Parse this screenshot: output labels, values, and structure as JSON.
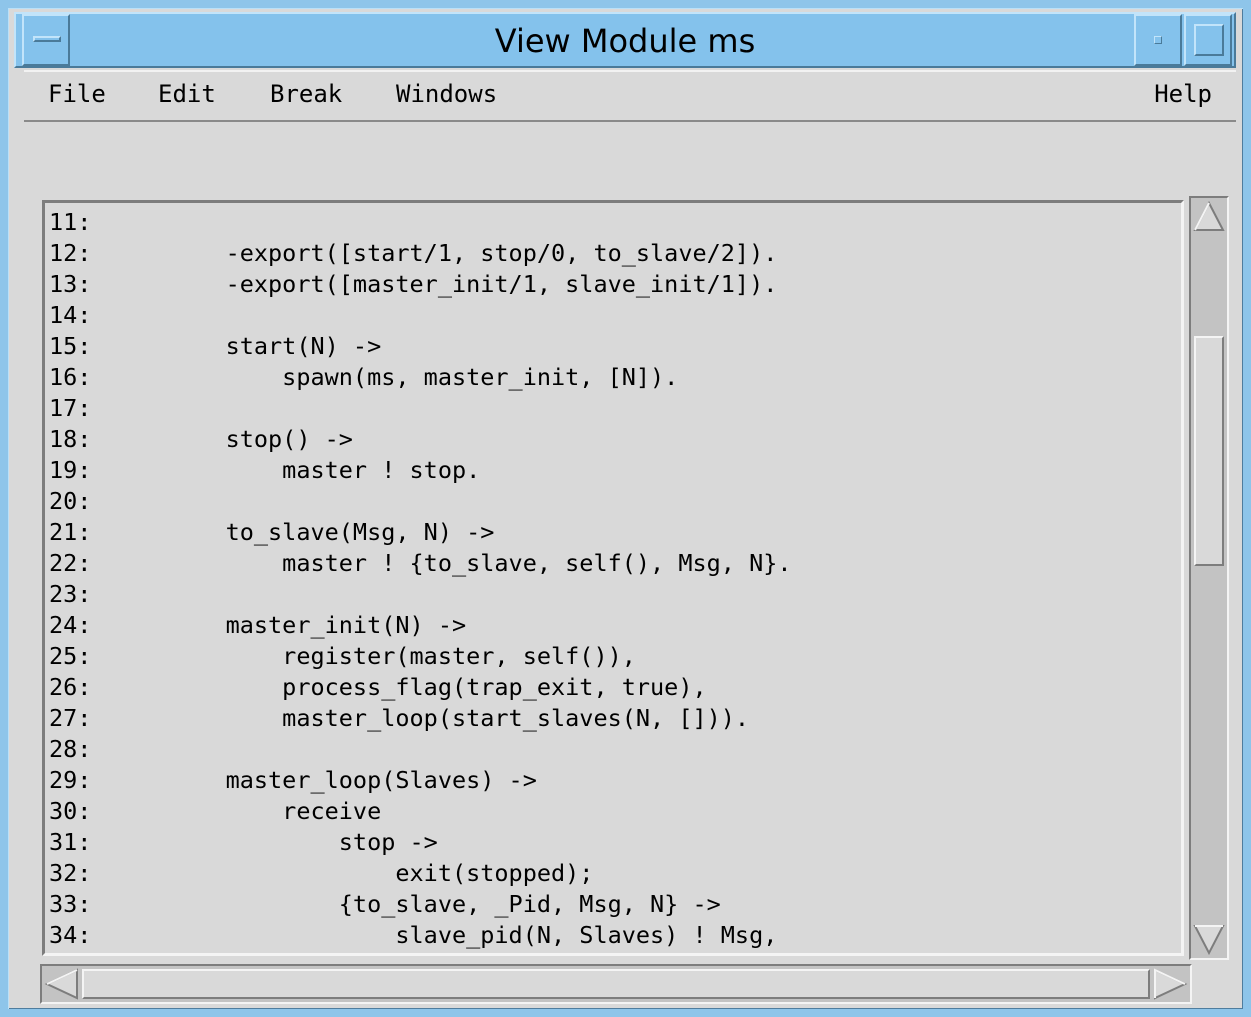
{
  "window": {
    "title": "View Module ms",
    "frame_color": "#84c2ec",
    "background_color": "#d9d9d9"
  },
  "title_buttons": {
    "window_menu_icon": "window-menu-icon",
    "minimize_icon": "minimize-icon",
    "maximize_icon": "maximize-icon"
  },
  "menubar": {
    "file": "File",
    "edit": "Edit",
    "break": "Break",
    "windows": "Windows",
    "help": "Help"
  },
  "code": {
    "lines": [
      {
        "num": "11:",
        "text": ""
      },
      {
        "num": "12:",
        "text": "    -export([start/1, stop/0, to_slave/2])."
      },
      {
        "num": "13:",
        "text": "    -export([master_init/1, slave_init/1])."
      },
      {
        "num": "14:",
        "text": ""
      },
      {
        "num": "15:",
        "text": "    start(N) ->"
      },
      {
        "num": "16:",
        "text": "        spawn(ms, master_init, [N])."
      },
      {
        "num": "17:",
        "text": ""
      },
      {
        "num": "18:",
        "text": "    stop() ->"
      },
      {
        "num": "19:",
        "text": "        master ! stop."
      },
      {
        "num": "20:",
        "text": ""
      },
      {
        "num": "21:",
        "text": "    to_slave(Msg, N) ->"
      },
      {
        "num": "22:",
        "text": "        master ! {to_slave, self(), Msg, N}."
      },
      {
        "num": "23:",
        "text": ""
      },
      {
        "num": "24:",
        "text": "    master_init(N) ->"
      },
      {
        "num": "25:",
        "text": "        register(master, self()),"
      },
      {
        "num": "26:",
        "text": "        process_flag(trap_exit, true),"
      },
      {
        "num": "27:",
        "text": "        master_loop(start_slaves(N, []))."
      },
      {
        "num": "28:",
        "text": ""
      },
      {
        "num": "29:",
        "text": "    master_loop(Slaves) ->"
      },
      {
        "num": "30:",
        "text": "        receive"
      },
      {
        "num": "31:",
        "text": "            stop ->"
      },
      {
        "num": "32:",
        "text": "                exit(stopped);"
      },
      {
        "num": "33:",
        "text": "            {to_slave, _Pid, Msg, N} ->"
      },
      {
        "num": "34:",
        "text": "                slave_pid(N, Slaves) ! Msg,"
      }
    ]
  },
  "scrollbars": {
    "up_icon": "arrow-up-icon",
    "down_icon": "arrow-down-icon",
    "left_icon": "arrow-left-icon",
    "right_icon": "arrow-right-icon"
  }
}
